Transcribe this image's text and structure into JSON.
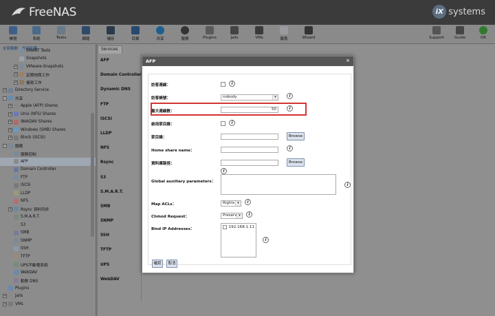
{
  "app": {
    "logo_text": "FreeNAS",
    "vendor_text": "systems",
    "vendor_mark": "iX"
  },
  "toolbar": {
    "items": [
      {
        "label": "帳號",
        "icon": "account-icon"
      },
      {
        "label": "系統",
        "icon": "system-icon"
      },
      {
        "label": "Tasks",
        "icon": "tasks-icon"
      },
      {
        "label": "網路",
        "icon": "network-icon"
      },
      {
        "label": "儲存",
        "icon": "storage-icon"
      },
      {
        "label": "目錄",
        "icon": "directory-icon"
      },
      {
        "label": "共享",
        "icon": "sharing-icon"
      },
      {
        "label": "服務",
        "icon": "services-icon"
      },
      {
        "label": "Plugins",
        "icon": "plugins-icon"
      },
      {
        "label": "Jails",
        "icon": "jails-icon"
      },
      {
        "label": "VMs",
        "icon": "vms-icon"
      },
      {
        "label": "報表",
        "icon": "reporting-icon"
      },
      {
        "label": "Wizard",
        "icon": "wizard-icon"
      },
      {
        "label": "Support",
        "icon": "support-icon"
      },
      {
        "label": "Guide",
        "icon": "guide-icon"
      },
      {
        "label": "OK",
        "icon": "alert-ok-icon"
      }
    ]
  },
  "tree": {
    "top_links": [
      "全部展開",
      "全部折疊"
    ],
    "rows": [
      {
        "label": "SMART Tests",
        "indent": 2,
        "icon": "#7a8fa6"
      },
      {
        "label": "Snapshots",
        "indent": 2,
        "icon": "#9aa2ad"
      },
      {
        "label": "VMware-Snapshots",
        "indent": 2,
        "toggle": "+",
        "icon": "#7e8c9a"
      },
      {
        "label": "定期快照工作",
        "indent": 2,
        "toggle": "+",
        "icon": "#a08060"
      },
      {
        "label": "複寫工作",
        "indent": 2,
        "toggle": "+",
        "icon": "#8a7a60"
      },
      {
        "label": "Directory Service",
        "indent": 0,
        "toggle": "+",
        "icon": "#6f7f95"
      },
      {
        "label": "共享",
        "indent": 0,
        "toggle": "-",
        "icon": "#6a8ab0"
      },
      {
        "label": "Apple (AFP) Shares",
        "indent": 1,
        "toggle": "+",
        "icon": "#888888"
      },
      {
        "label": "Unix (NFS) Shares",
        "indent": 1,
        "toggle": "+",
        "icon": "#6a7ab8"
      },
      {
        "label": "WebDAV Shares",
        "indent": 1,
        "toggle": "+",
        "icon": "#b06a6a"
      },
      {
        "label": "Windows (SMB) Shares",
        "indent": 1,
        "toggle": "+",
        "icon": "#6a9ac0"
      },
      {
        "label": "Block (iSCSI)",
        "indent": 1,
        "toggle": "+",
        "icon": "#7a7a7a"
      },
      {
        "label": "服務",
        "indent": 0,
        "toggle": "-",
        "icon": "#7a8a9a"
      },
      {
        "label": "服務控制",
        "indent": 1,
        "icon": "#7a8a9a"
      },
      {
        "label": "AFP",
        "indent": 1,
        "icon": "#8a8a8a",
        "selected": true
      },
      {
        "label": "Domain Controller",
        "indent": 1,
        "icon": "#6a7a9a"
      },
      {
        "label": "FTP",
        "indent": 1,
        "icon": "#7a8aa0"
      },
      {
        "label": "iSCSI",
        "indent": 1,
        "icon": "#7a7a7a"
      },
      {
        "label": "LLDP",
        "indent": 1,
        "icon": "#9a9a7a"
      },
      {
        "label": "NFS",
        "indent": 1,
        "icon": "#b07070"
      },
      {
        "label": "Rsync 資料同步",
        "indent": 1,
        "toggle": "+",
        "icon": "#6a8aa0"
      },
      {
        "label": "S.M.A.R.T.",
        "indent": 1,
        "icon": "#7a8a7a"
      },
      {
        "label": "S3",
        "indent": 1,
        "icon": "#8a8a8a"
      },
      {
        "label": "SMB",
        "indent": 1,
        "icon": "#7a7a9a"
      },
      {
        "label": "SNMP",
        "indent": 1,
        "icon": "#7a8a9a"
      },
      {
        "label": "SSH",
        "indent": 1,
        "icon": "#8a9aaa"
      },
      {
        "label": "TFTP",
        "indent": 1,
        "icon": "#9a8a7a"
      },
      {
        "label": "UPS不斷電系統",
        "indent": 1,
        "icon": "#7a8a7a"
      },
      {
        "label": "WebDAV",
        "indent": 1,
        "icon": "#6a8ab0"
      },
      {
        "label": "動態 DNS",
        "indent": 1,
        "icon": "#8a7a9a"
      },
      {
        "label": "Plugins",
        "indent": 0,
        "icon": "#6a8ab0"
      },
      {
        "label": "Jails",
        "indent": 0,
        "toggle": "+",
        "icon": "#8a8a8a"
      },
      {
        "label": "VMs",
        "indent": 0,
        "toggle": "+",
        "icon": "#7a7a7a"
      }
    ]
  },
  "services": {
    "tab_label": "Services",
    "names": [
      "AFP",
      "Domain Controller",
      "Dynamic DNS",
      "FTP",
      "iSCSI",
      "LLDP",
      "NFS",
      "Rsync",
      "S3",
      "S.M.A.R.T.",
      "SMB",
      "SNMP",
      "SSH",
      "TFTP",
      "UPS",
      "WebDAV"
    ]
  },
  "modal": {
    "title": "AFP",
    "close_glyph": "×",
    "fields": {
      "guest_access_label": "訪客連線：",
      "guest_account_label": "訪客帳號：",
      "guest_account_value": "nobody",
      "max_connections_label": "最大連線數：",
      "max_connections_value": "50",
      "enable_home_label": "啟用家目錄：",
      "home_dir_label": "家目錄：",
      "home_dir_value": "",
      "home_share_name_label": "Home share name：",
      "home_share_name_value": "",
      "db_path_label": "資料庫路徑：",
      "db_path_value": "",
      "global_aux_label": "Global auxiliary parameters：",
      "map_acls_label": "Map ACLs：",
      "map_acls_value": "Rights",
      "chmod_label": "Chmod Request：",
      "chmod_value": "Preserve",
      "bind_ip_label": "Bind IP Addresses：",
      "bind_ip_options": [
        "192.168.1.11"
      ]
    },
    "browse_label": "Browse",
    "help_glyph": "i",
    "ok_label": "確認",
    "cancel_label": "取消",
    "highlight_color": "#d33333"
  }
}
